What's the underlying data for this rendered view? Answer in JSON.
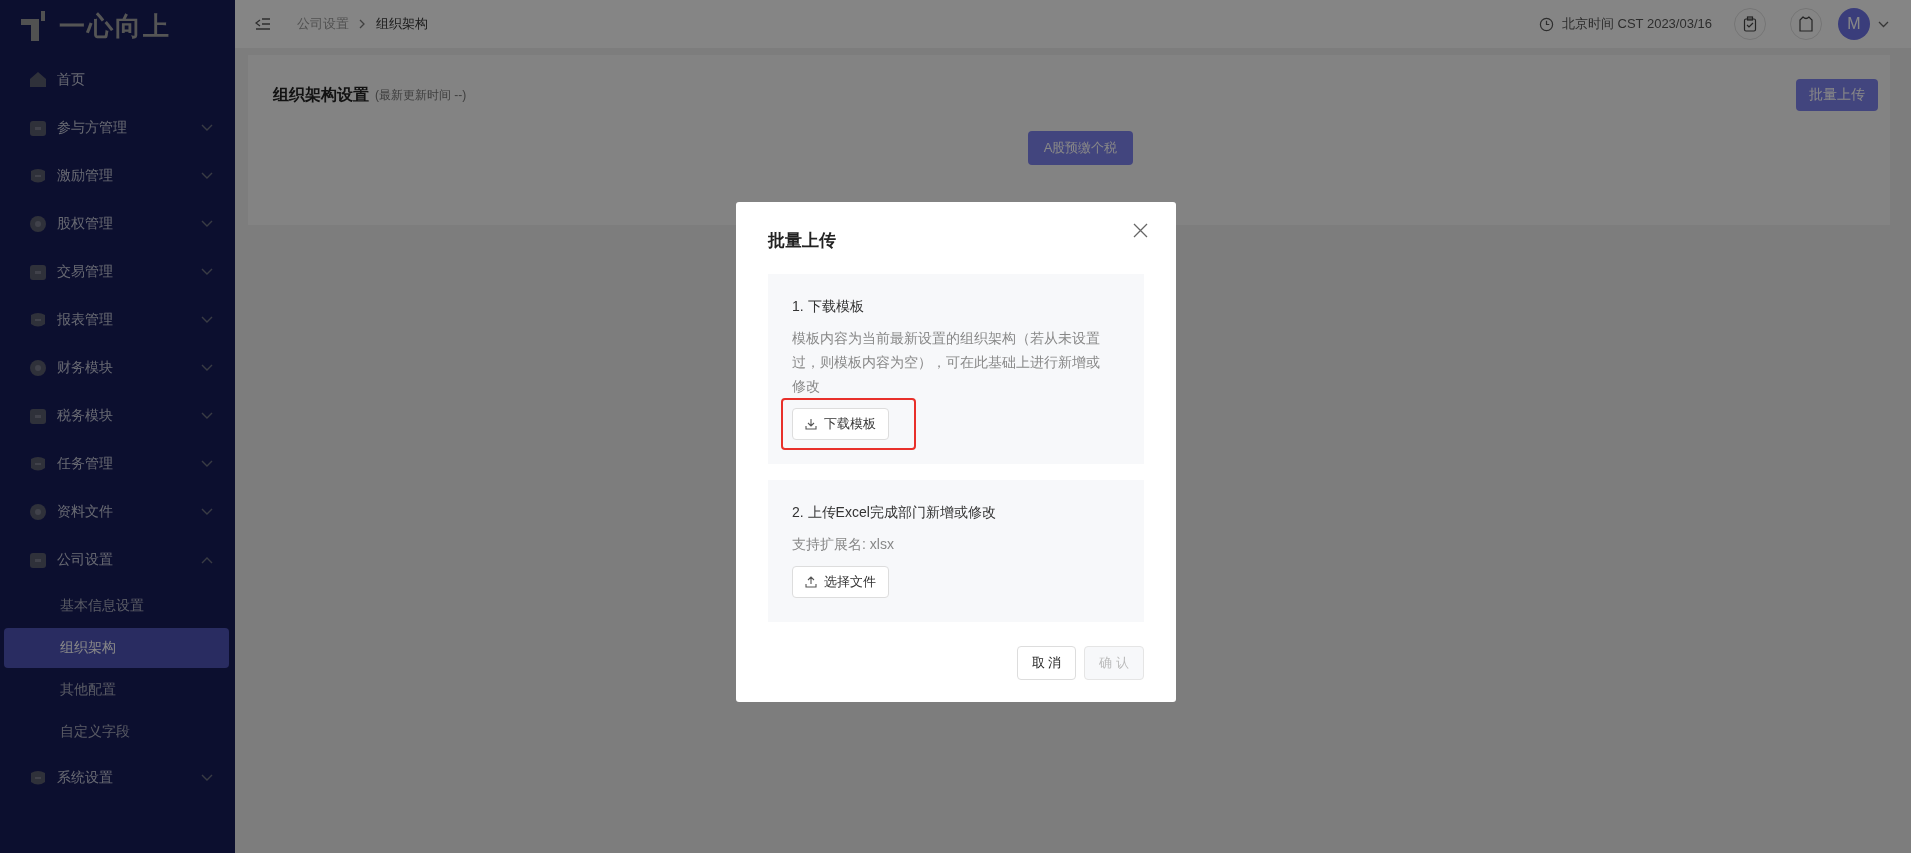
{
  "logo": {
    "text": "一心向上"
  },
  "sidebar": {
    "items": [
      {
        "label": "首页",
        "kind": "link"
      },
      {
        "label": "参与方管理",
        "kind": "group",
        "expanded": false
      },
      {
        "label": "激励管理",
        "kind": "group",
        "expanded": false
      },
      {
        "label": "股权管理",
        "kind": "group",
        "expanded": false
      },
      {
        "label": "交易管理",
        "kind": "group",
        "expanded": false
      },
      {
        "label": "报表管理",
        "kind": "group",
        "expanded": false
      },
      {
        "label": "财务模块",
        "kind": "group",
        "expanded": false
      },
      {
        "label": "税务模块",
        "kind": "group",
        "expanded": false
      },
      {
        "label": "任务管理",
        "kind": "group",
        "expanded": false
      },
      {
        "label": "资料文件",
        "kind": "group",
        "expanded": false
      },
      {
        "label": "公司设置",
        "kind": "group",
        "expanded": true,
        "children": [
          {
            "label": "基本信息设置",
            "selected": false
          },
          {
            "label": "组织架构",
            "selected": true
          },
          {
            "label": "其他配置",
            "selected": false
          },
          {
            "label": "自定义字段",
            "selected": false
          }
        ]
      },
      {
        "label": "系统设置",
        "kind": "group",
        "expanded": false
      }
    ]
  },
  "header": {
    "breadcrumb": [
      "公司设置",
      "组织架构"
    ],
    "time": "北京时间 CST 2023/03/16",
    "avatar": "M"
  },
  "page": {
    "title": "组织架构设置",
    "subtitle": "(最新更新时间 --)",
    "upload_button": "批量上传",
    "tab_button": "A股预缴个税"
  },
  "modal": {
    "title": "批量上传",
    "sections": [
      {
        "heading": "1. 下载模板",
        "description": "模板内容为当前最新设置的组织架构（若从未设置过，则模板内容为空），可在此基础上进行新增或修改",
        "button": "下载模板",
        "highlighted": true
      },
      {
        "heading": "2. 上传Excel完成部门新增或修改",
        "description": "支持扩展名: xlsx",
        "button": "选择文件",
        "highlighted": false
      }
    ],
    "buttons": [
      {
        "label": "取 消",
        "disabled": false
      },
      {
        "label": "确 认",
        "disabled": true
      }
    ]
  }
}
